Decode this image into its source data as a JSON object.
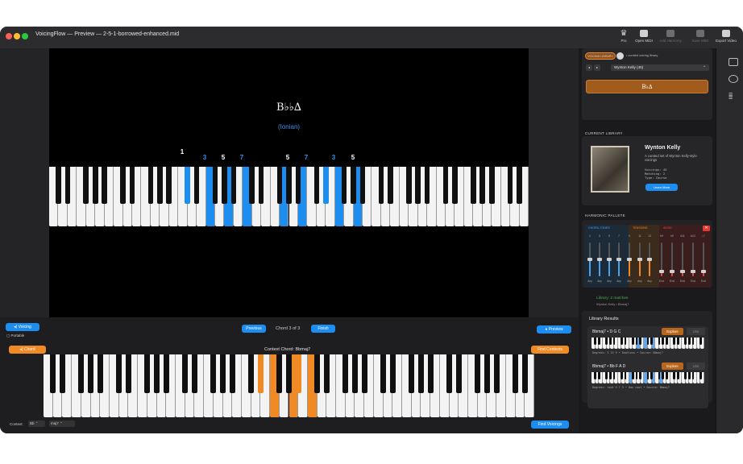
{
  "window": {
    "title": "VoicingFlow — Preview — 2-5-1-borrowed-enhanced.mid",
    "toolbar": [
      {
        "label": "Pro",
        "icon": "crown-icon",
        "enabled": true
      },
      {
        "label": "Open MIDI",
        "icon": "folder-icon",
        "enabled": true
      },
      {
        "label": "Add Harmony",
        "icon": "wand-icon",
        "enabled": false
      },
      {
        "label": "Save MIDI",
        "icon": "save-icon",
        "enabled": false
      },
      {
        "label": "Export Video",
        "icon": "export-icon",
        "enabled": true
      }
    ]
  },
  "preview": {
    "chord_symbol": "B♭♭∆",
    "mode": "(Ionian)",
    "degree_labels": [
      "1",
      "3",
      "5",
      "7",
      "5",
      "7",
      "3",
      "5"
    ],
    "highlight_color": "#1d8ef0"
  },
  "controls": {
    "voicing_label": "Voicing",
    "portable_label": "Portable",
    "previous_label": "Previous",
    "chord_counter": "Chord 3 of 3",
    "finish_label": "Finish",
    "preview_label": "Preview",
    "chord_label": "Chord",
    "context_chord": "Context Chord: Bbmaj7",
    "find_contexts_label": "Find Contexts",
    "context_label": "Context:",
    "root_value": "Bb",
    "quality_value": "maj7",
    "find_voicings_label": "Find Voicings",
    "accent_color": "#f08a24"
  },
  "library": {
    "toggle_label": "VOICING LIBRARY",
    "toggle_subtitle": "• curated voicing library",
    "selected": "Wynton Kelly (45)",
    "chord_display": "B♭∆",
    "current_header": "CURRENT LIBRARY",
    "artist_name": "Wynton Kelly",
    "artist_desc": "A curated set of Wynton Kelly-style voicings",
    "stats": [
      "Voicings: 45",
      "Matching: 2",
      "Type: Course"
    ],
    "learn_more": "Learn More",
    "palette_header": "HARMONIC PALLETE",
    "palette_tabs": [
      "CHORD-TONES",
      "TENSIONS",
      "AVOID"
    ],
    "slider_top": [
      "1",
      "3",
      "5",
      "7",
      "9",
      "11",
      "13",
      "b9",
      "#9",
      "#11",
      "b13",
      "♭7"
    ],
    "slider_bottom": [
      "Any",
      "Any",
      "Any",
      "Any",
      "Any",
      "Any",
      "Any",
      "Excl",
      "Excl",
      "Excl",
      "Excl",
      "Excl"
    ],
    "slider_levels": [
      0.5,
      0.5,
      0.5,
      0.5,
      0.5,
      0.5,
      0.5,
      0.15,
      0.15,
      0.15,
      0.15,
      0.15
    ],
    "matches_text": "Library: 2 matches",
    "matches_sub": "Wynton Kelly • Bbmaj7",
    "results_header": "Library Results",
    "results": [
      {
        "title": "Bbmaj7 • D G C",
        "degrees": "Degrees: 3 13 9  •  Rootless  •  Source: Bbmaj7",
        "explore": "Explore",
        "use": "Use"
      },
      {
        "title": "Bbmaj7 • Bb F A D",
        "degrees": "Degrees: root 5 7 3  •  Has root  •  Source: Bbmaj7",
        "explore": "Explore",
        "use": "Use"
      }
    ]
  }
}
